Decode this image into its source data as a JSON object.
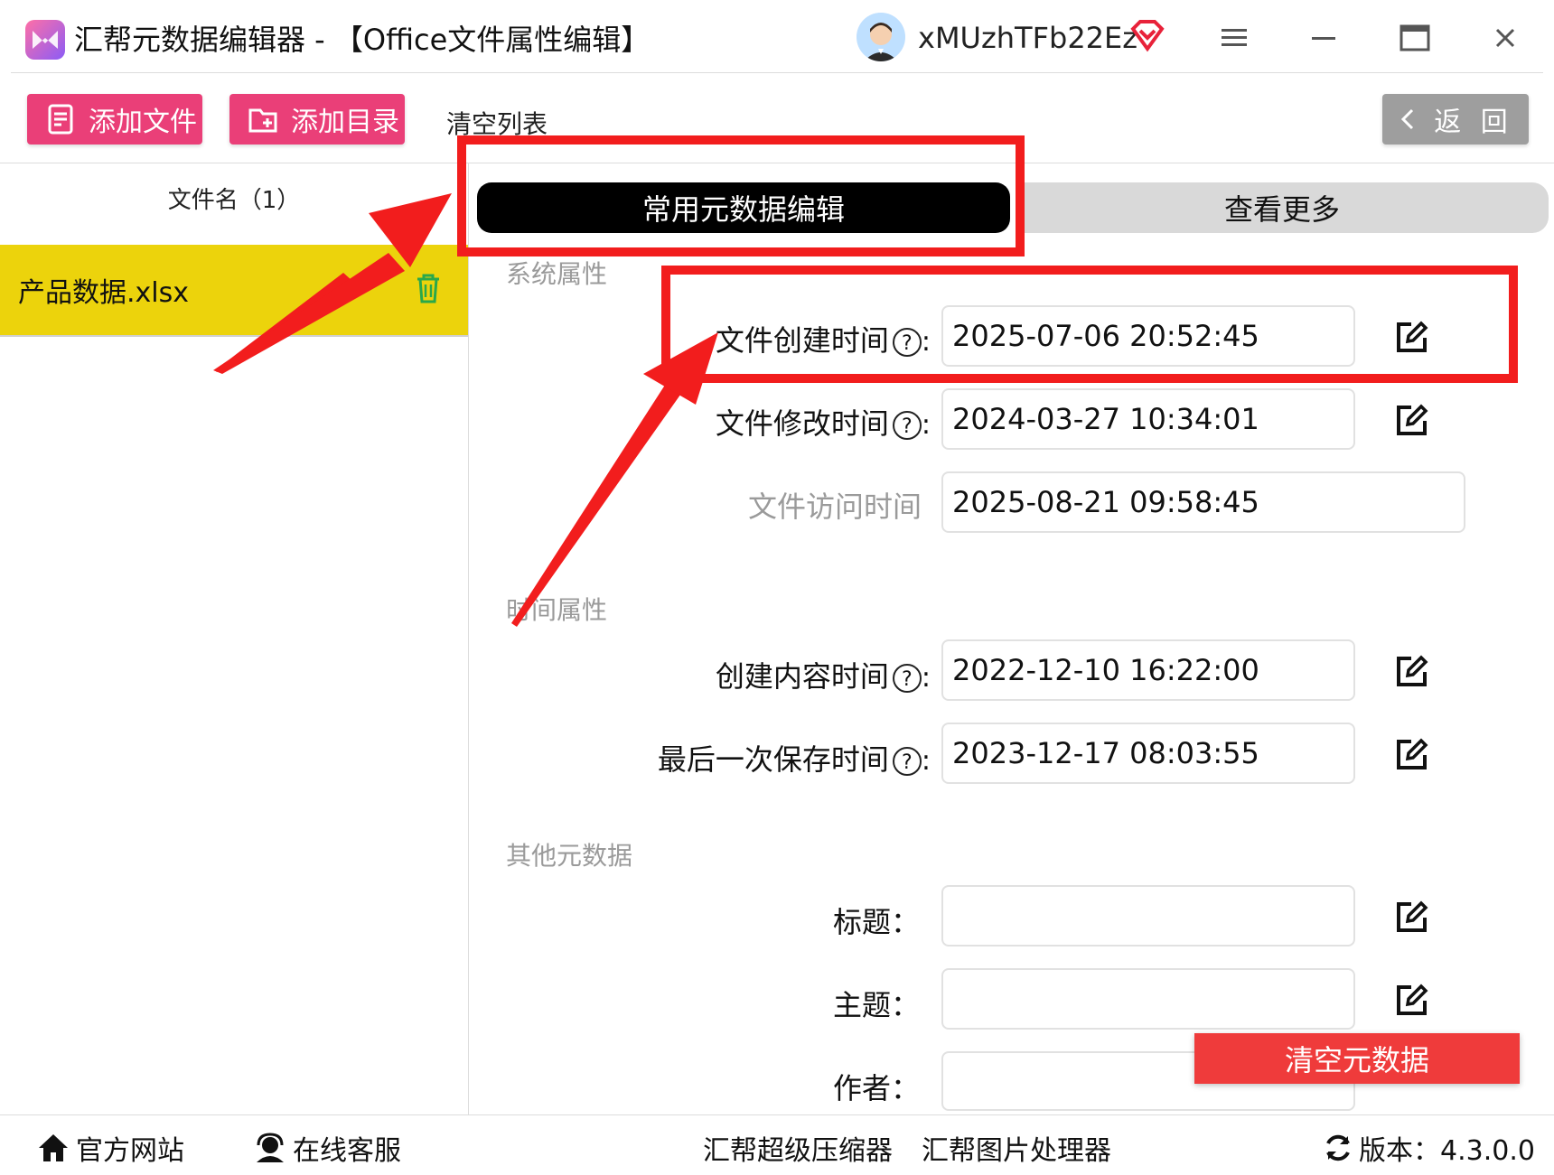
{
  "window": {
    "title": "汇帮元数据编辑器 - 【Office文件属性编辑】",
    "username": "xMUzhTFb22Ez"
  },
  "toolbar": {
    "add_file": "添加文件",
    "add_dir": "添加目录",
    "clear_list": "清空列表",
    "back": "返 回"
  },
  "sidebar": {
    "header": "文件名（1）",
    "files": [
      {
        "name": "产品数据.xlsx"
      }
    ]
  },
  "tabs": {
    "active": "常用元数据编辑",
    "more": "查看更多"
  },
  "sections": {
    "system": "系统属性",
    "time": "时间属性",
    "other": "其他元数据"
  },
  "fields": {
    "file_created": {
      "label": "文件创建时间",
      "value": "2025-07-06 20:52:45"
    },
    "file_modified": {
      "label": "文件修改时间",
      "value": "2024-03-27 10:34:01"
    },
    "file_accessed": {
      "label": "文件访问时间",
      "value": "2025-08-21 09:58:45"
    },
    "content_created": {
      "label": "创建内容时间",
      "value": "2022-12-10 16:22:00"
    },
    "last_saved": {
      "label": "最后一次保存时间",
      "value": "2023-12-17 08:03:55"
    },
    "title": {
      "label": "标题：",
      "value": ""
    },
    "subject": {
      "label": "主题：",
      "value": ""
    },
    "author": {
      "label": "作者：",
      "value": ""
    }
  },
  "help_glyph": "?",
  "colon": ":",
  "actions": {
    "clear_metadata": "清空元数据"
  },
  "footer": {
    "website": "官方网站",
    "support": "在线客服",
    "compressor": "汇帮超级压缩器",
    "image_tool": "汇帮图片处理器",
    "version": "版本：4.3.0.0"
  },
  "colors": {
    "accent_pink": "#ea3f78",
    "selected_row": "#ecd30c",
    "annotation_red": "#f21d1d",
    "danger": "#ef3b3b"
  }
}
